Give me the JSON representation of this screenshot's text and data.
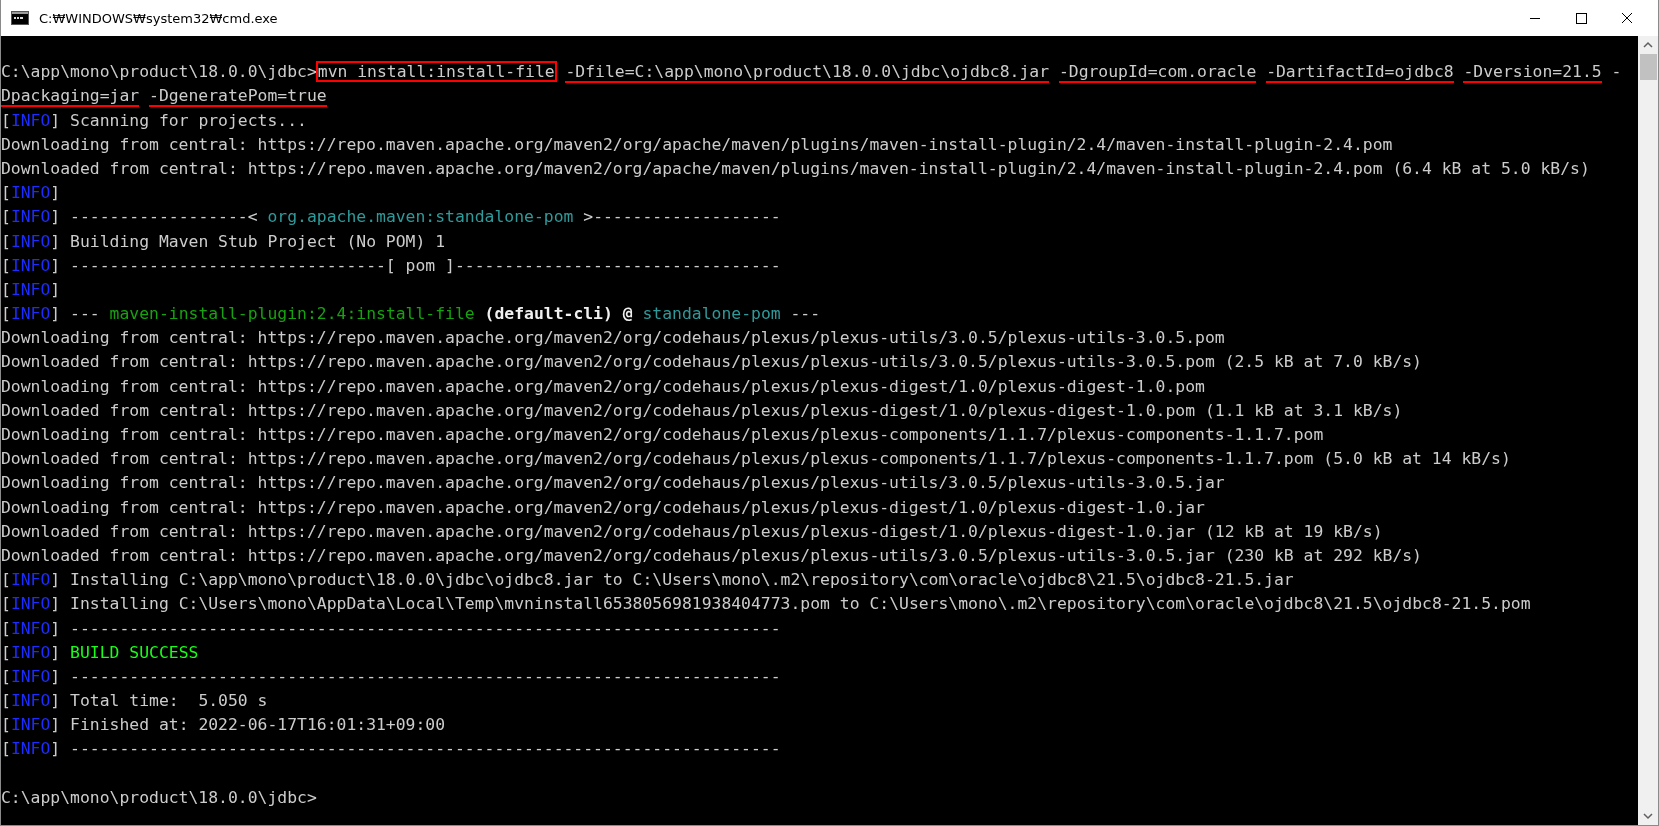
{
  "window": {
    "title": "C:₩WINDOWS₩system32₩cmd.exe"
  },
  "console": {
    "lines": [
      {
        "kind": "blank"
      },
      {
        "kind": "text",
        "segments": [
          {
            "text": "C:\\app\\mono\\product\\18.0.0\\jdbc>",
            "kind": "text"
          },
          {
            "text": "mvn install:install-file",
            "kind": "boxed"
          },
          {
            "text": "-Dfile=C:\\app\\mono\\product\\18.0.0\\jdbc\\ojdbc8.jar",
            "kind": "underlined"
          },
          {
            "text": "-DgroupId=com.oracle",
            "kind": "underlined"
          },
          {
            "text": "-DartifactId=ojdbc8",
            "kind": "underlined"
          },
          {
            "text": "-Dversion=21.5",
            "kind": "underlined"
          },
          {
            "text": " -",
            "kind": "text"
          }
        ]
      },
      {
        "kind": "text",
        "segments": [
          {
            "text": "Dpackaging=jar",
            "kind": "underlined"
          },
          {
            "text": "-DgeneratePom=true",
            "kind": "underlined"
          }
        ]
      },
      {
        "kind": "text",
        "segments": [
          {
            "text": "[",
            "kind": "text"
          },
          {
            "text": "INFO",
            "kind": "info"
          },
          {
            "text": "] Scanning for projects...",
            "kind": "text"
          }
        ]
      },
      {
        "kind": "text",
        "segments": [
          {
            "text": "Downloading from central: https://repo.maven.apache.org/maven2/org/apache/maven/plugins/maven-install-plugin/2.4/maven-install-plugin-2.4.pom",
            "kind": "text"
          }
        ]
      },
      {
        "kind": "text",
        "segments": [
          {
            "text": "Downloaded from central: https://repo.maven.apache.org/maven2/org/apache/maven/plugins/maven-install-plugin/2.4/maven-install-plugin-2.4.pom (6.4 kB at 5.0 kB/s)",
            "kind": "text"
          }
        ]
      },
      {
        "kind": "text",
        "segments": [
          {
            "text": "[",
            "kind": "text"
          },
          {
            "text": "INFO",
            "kind": "info"
          },
          {
            "text": "]",
            "kind": "text"
          }
        ]
      },
      {
        "kind": "text",
        "segments": [
          {
            "text": "[",
            "kind": "text"
          },
          {
            "text": "INFO",
            "kind": "info"
          },
          {
            "text": "] ------------------< ",
            "kind": "text"
          },
          {
            "text": "org.apache.maven:standalone-pom",
            "kind": "project"
          },
          {
            "text": " >-------------------",
            "kind": "text"
          }
        ]
      },
      {
        "kind": "text",
        "segments": [
          {
            "text": "[",
            "kind": "text"
          },
          {
            "text": "INFO",
            "kind": "info"
          },
          {
            "text": "] Building Maven Stub Project (No POM) 1",
            "kind": "text"
          }
        ]
      },
      {
        "kind": "text",
        "segments": [
          {
            "text": "[",
            "kind": "text"
          },
          {
            "text": "INFO",
            "kind": "info"
          },
          {
            "text": "] --------------------------------[ pom ]---------------------------------",
            "kind": "text"
          }
        ]
      },
      {
        "kind": "text",
        "segments": [
          {
            "text": "[",
            "kind": "text"
          },
          {
            "text": "INFO",
            "kind": "info"
          },
          {
            "text": "]",
            "kind": "text"
          }
        ]
      },
      {
        "kind": "text",
        "segments": [
          {
            "text": "[",
            "kind": "text"
          },
          {
            "text": "INFO",
            "kind": "info"
          },
          {
            "text": "] --- ",
            "kind": "text"
          },
          {
            "text": "maven-install-plugin:2.4:install-file",
            "kind": "plugin"
          },
          {
            "text": " (default-cli) @ ",
            "kind": "emphasis"
          },
          {
            "text": "standalone-pom",
            "kind": "project"
          },
          {
            "text": " ---",
            "kind": "text"
          }
        ]
      },
      {
        "kind": "text",
        "segments": [
          {
            "text": "Downloading from central: https://repo.maven.apache.org/maven2/org/codehaus/plexus/plexus-utils/3.0.5/plexus-utils-3.0.5.pom",
            "kind": "text"
          }
        ]
      },
      {
        "kind": "text",
        "segments": [
          {
            "text": "Downloaded from central: https://repo.maven.apache.org/maven2/org/codehaus/plexus/plexus-utils/3.0.5/plexus-utils-3.0.5.pom (2.5 kB at 7.0 kB/s)",
            "kind": "text"
          }
        ]
      },
      {
        "kind": "text",
        "segments": [
          {
            "text": "Downloading from central: https://repo.maven.apache.org/maven2/org/codehaus/plexus/plexus-digest/1.0/plexus-digest-1.0.pom",
            "kind": "text"
          }
        ]
      },
      {
        "kind": "text",
        "segments": [
          {
            "text": "Downloaded from central: https://repo.maven.apache.org/maven2/org/codehaus/plexus/plexus-digest/1.0/plexus-digest-1.0.pom (1.1 kB at 3.1 kB/s)",
            "kind": "text"
          }
        ]
      },
      {
        "kind": "text",
        "segments": [
          {
            "text": "Downloading from central: https://repo.maven.apache.org/maven2/org/codehaus/plexus/plexus-components/1.1.7/plexus-components-1.1.7.pom",
            "kind": "text"
          }
        ]
      },
      {
        "kind": "text",
        "segments": [
          {
            "text": "Downloaded from central: https://repo.maven.apache.org/maven2/org/codehaus/plexus/plexus-components/1.1.7/plexus-components-1.1.7.pom (5.0 kB at 14 kB/s)",
            "kind": "text"
          }
        ]
      },
      {
        "kind": "text",
        "segments": [
          {
            "text": "Downloading from central: https://repo.maven.apache.org/maven2/org/codehaus/plexus/plexus-utils/3.0.5/plexus-utils-3.0.5.jar",
            "kind": "text"
          }
        ]
      },
      {
        "kind": "text",
        "segments": [
          {
            "text": "Downloading from central: https://repo.maven.apache.org/maven2/org/codehaus/plexus/plexus-digest/1.0/plexus-digest-1.0.jar",
            "kind": "text"
          }
        ]
      },
      {
        "kind": "text",
        "segments": [
          {
            "text": "Downloaded from central: https://repo.maven.apache.org/maven2/org/codehaus/plexus/plexus-digest/1.0/plexus-digest-1.0.jar (12 kB at 19 kB/s)",
            "kind": "text"
          }
        ]
      },
      {
        "kind": "text",
        "segments": [
          {
            "text": "Downloaded from central: https://repo.maven.apache.org/maven2/org/codehaus/plexus/plexus-utils/3.0.5/plexus-utils-3.0.5.jar (230 kB at 292 kB/s)",
            "kind": "text"
          }
        ]
      },
      {
        "kind": "text",
        "segments": [
          {
            "text": "[",
            "kind": "text"
          },
          {
            "text": "INFO",
            "kind": "info"
          },
          {
            "text": "] Installing C:\\app\\mono\\product\\18.0.0\\jdbc\\ojdbc8.jar to C:\\Users\\mono\\.m2\\repository\\com\\oracle\\ojdbc8\\21.5\\ojdbc8-21.5.jar",
            "kind": "text"
          }
        ]
      },
      {
        "kind": "text",
        "segments": [
          {
            "text": "[",
            "kind": "text"
          },
          {
            "text": "INFO",
            "kind": "info"
          },
          {
            "text": "] Installing C:\\Users\\mono\\AppData\\Local\\Temp\\mvninstall6538056981938404773.pom to C:\\Users\\mono\\.m2\\repository\\com\\oracle\\ojdbc8\\21.5\\ojdbc8-21.5.pom",
            "kind": "text"
          }
        ]
      },
      {
        "kind": "text",
        "segments": [
          {
            "text": "[",
            "kind": "text"
          },
          {
            "text": "INFO",
            "kind": "info"
          },
          {
            "text": "] ------------------------------------------------------------------------",
            "kind": "text"
          }
        ]
      },
      {
        "kind": "text",
        "segments": [
          {
            "text": "[",
            "kind": "text"
          },
          {
            "text": "INFO",
            "kind": "info"
          },
          {
            "text": "] ",
            "kind": "text"
          },
          {
            "text": "BUILD SUCCESS",
            "kind": "status"
          }
        ]
      },
      {
        "kind": "text",
        "segments": [
          {
            "text": "[",
            "kind": "text"
          },
          {
            "text": "INFO",
            "kind": "info"
          },
          {
            "text": "] ------------------------------------------------------------------------",
            "kind": "text"
          }
        ]
      },
      {
        "kind": "text",
        "segments": [
          {
            "text": "[",
            "kind": "text"
          },
          {
            "text": "INFO",
            "kind": "info"
          },
          {
            "text": "] Total time:  5.050 s",
            "kind": "text"
          }
        ]
      },
      {
        "kind": "text",
        "segments": [
          {
            "text": "[",
            "kind": "text"
          },
          {
            "text": "INFO",
            "kind": "info"
          },
          {
            "text": "] Finished at: 2022-06-17T16:01:31+09:00",
            "kind": "text"
          }
        ]
      },
      {
        "kind": "text",
        "segments": [
          {
            "text": "[",
            "kind": "text"
          },
          {
            "text": "INFO",
            "kind": "info"
          },
          {
            "text": "] ------------------------------------------------------------------------",
            "kind": "text"
          }
        ]
      },
      {
        "kind": "blank"
      },
      {
        "kind": "text",
        "segments": [
          {
            "text": "C:\\app\\mono\\product\\18.0.0\\jdbc>",
            "kind": "text"
          }
        ]
      }
    ]
  }
}
